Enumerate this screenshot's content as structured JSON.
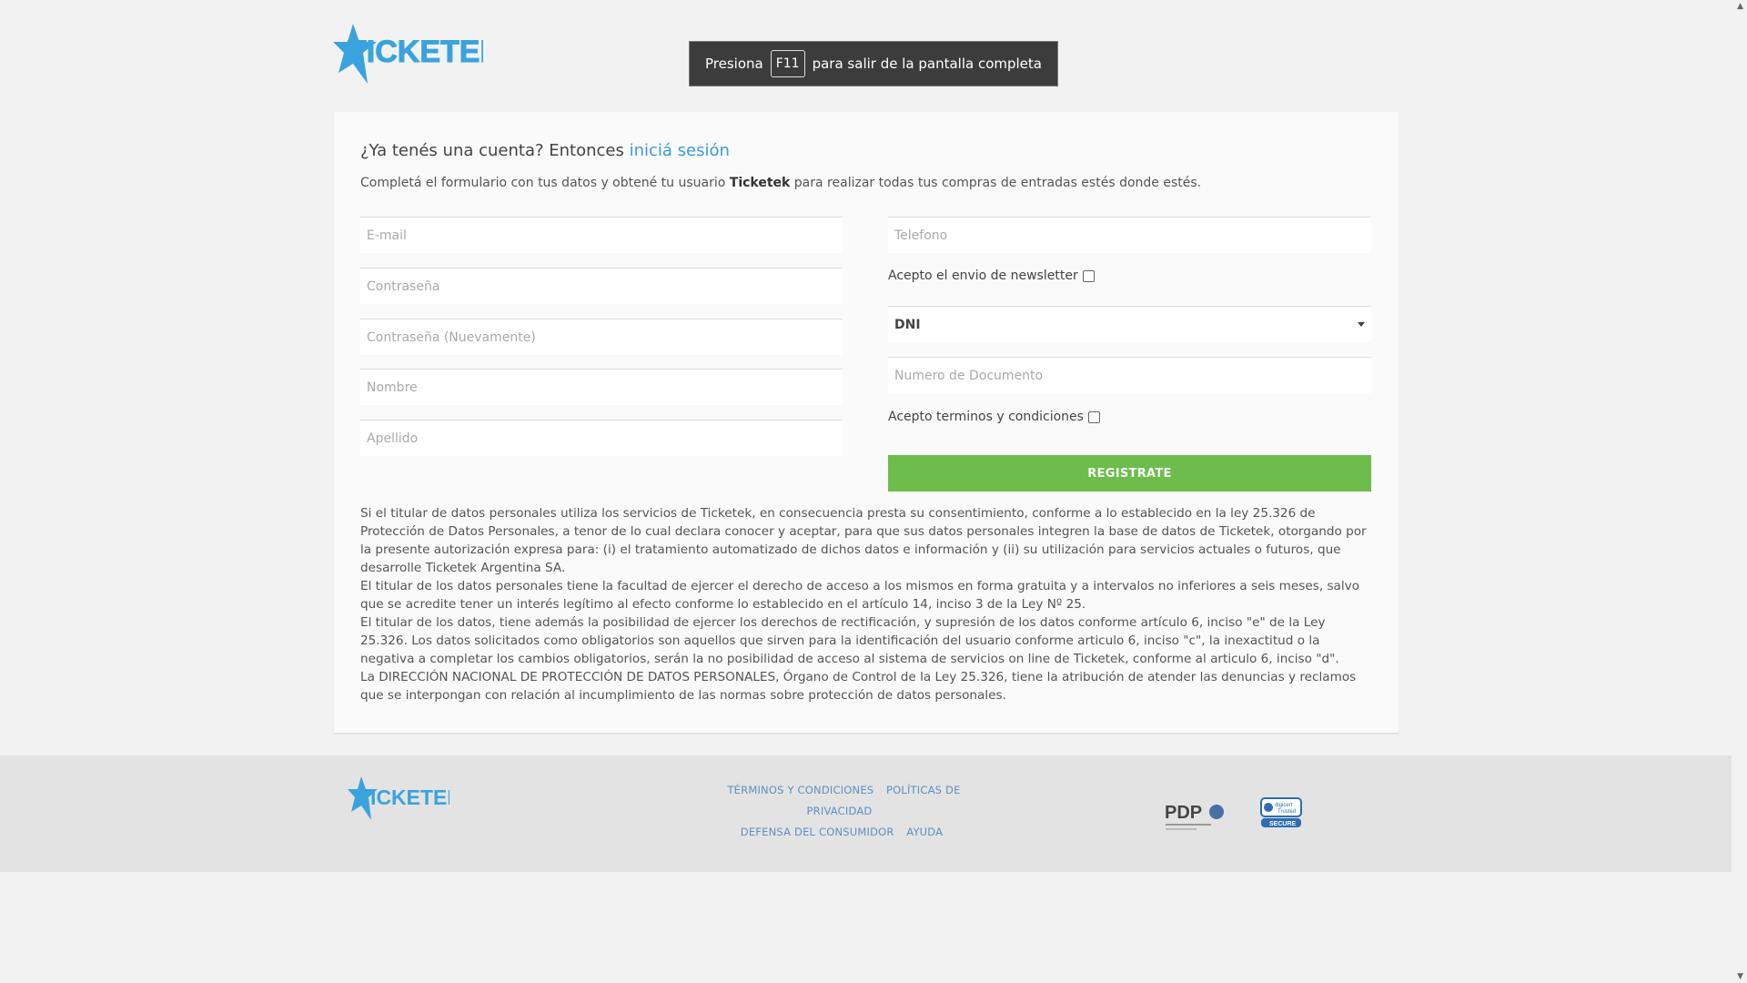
{
  "brand": {
    "logo_text": "TICKETEK"
  },
  "fullscreen_notice": {
    "prefix": "Presiona",
    "key": "F11",
    "suffix": "para salir de la pantalla completa"
  },
  "heading": {
    "prefix": "¿Ya tenés una cuenta? Entonces",
    "link": "iniciá sesión"
  },
  "intro": {
    "before": "Completá el formulario con tus datos y obtené tu usuario",
    "brand": "Ticketek",
    "after": "para realizar todas tus compras de entradas estés donde estés."
  },
  "form": {
    "email_placeholder": "E-mail",
    "password_placeholder": "Contraseña",
    "password_repeat_placeholder": "Contraseña (Nuevamente)",
    "name_placeholder": "Nombre",
    "lastname_placeholder": "Apellido",
    "phone_placeholder": "Telefono",
    "newsletter_label": "Acepto el envio de newsletter",
    "doc_type_selected": "DNI",
    "doc_number_placeholder": "Numero de Documento",
    "terms_label": "Acepto terminos y condiciones",
    "submit_label": "REGISTRATE"
  },
  "legal": [
    "Si el titular de datos personales utiliza los servicios de Ticketek, en consecuencia presta su consentimiento, conforme a lo establecido en la ley 25.326 de Protección de Datos Personales, a tenor de lo cual declara conocer y aceptar, para que sus datos personales integren la base de datos de Ticketek, otorgando por la presente autorización expresa para: (i) el tratamiento automatizado de dichos datos e información y (ii) su utilización para servicios actuales o futuros, que desarrolle Ticketek Argentina SA.",
    "El titular de los datos personales tiene la facultad de ejercer el derecho de acceso a los mismos en forma gratuita y a intervalos no inferiores a seis meses, salvo que se acredite tener un interés legítimo al efecto conforme lo establecido en el artículo 14, inciso 3 de la Ley Nº 25.",
    "El titular de los datos, tiene además la posibilidad de ejercer los derechos de rectificación, y supresión de los datos conforme artículo 6, inciso \"e\" de la Ley 25.326. Los datos solicitados como obligatorios son aquellos que sirven para la identificación del usuario conforme articulo 6, inciso \"c\", la inexactitud o la negativa a completar los cambios obligatorios, serán la no posibilidad de acceso al sistema de servicios on line de Ticketek, conforme al articulo 6, inciso \"d\".",
    "La DIRECCIÓN NACIONAL DE PROTECCIÓN DE DATOS PERSONALES, Órgano de Control de la Ley 25.326, tiene la atribución de atender las denuncias y reclamos que se interpongan con relación al incumplimiento de las normas sobre protección de datos personales."
  ],
  "footer": {
    "links": [
      "TÉRMINOS Y CONDICIONES",
      "POLÍTICAS DE PRIVACIDAD",
      "DEFENSA DEL CONSUMIDOR",
      "AYUDA"
    ],
    "pdp_text": "PDP",
    "digicert_text": "digicert trusted",
    "secure_text": "SECURE"
  },
  "colors": {
    "accent": "#3a9bd9",
    "button": "#6cbd4c",
    "logo": "#3aa3dd"
  }
}
